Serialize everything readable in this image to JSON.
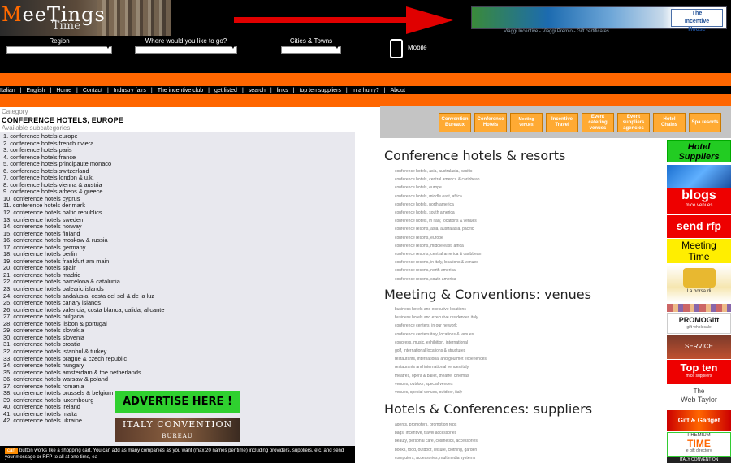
{
  "header": {
    "logo_part1_orange": "M",
    "logo_part1_rest": "eeTings",
    "logo_part2": "Time",
    "banner_logo_line1": "The",
    "banner_logo_line2": "Incentive",
    "banner_logo_line3": "House",
    "banner_sub": "Viaggi Incentive - Viaggi Premio - Gift certificates",
    "filters": [
      {
        "label": "Region"
      },
      {
        "label": "Where would you like to go?"
      },
      {
        "label": "Cities & Towns"
      }
    ],
    "mobile_label": "Mobile"
  },
  "nav": {
    "items": [
      "Italian",
      "|",
      "English",
      "|",
      "Home",
      "|",
      "Contact",
      "|",
      "Industry fairs",
      "|",
      "The incentive club",
      "|",
      "get listed",
      "|",
      "search",
      "|",
      "links",
      "|",
      "top ten suppliers",
      "|",
      "in a hurry?",
      "|",
      "About"
    ]
  },
  "left": {
    "category_label": "Category",
    "title": "CONFERENCE HOTELS, EUROPE",
    "available_label": "Available subcategories",
    "subcategories": [
      "1. conference hotels europe",
      "2. conference hotels french riviera",
      "3. conference hotels paris",
      "4. conference hotels france",
      "5. conference hotels principaute monaco",
      "6. conference hotels switzerland",
      "7. conference hotels london & u.k.",
      "8. conference hotels vienna & austria",
      "9. conference hotels athens & greece",
      "10. conference hotels cyprus",
      "11. conference hotels denmark",
      "12. conference hotels baltic republics",
      "13. conference hotels sweden",
      "14. conference hotels norway",
      "15. conference hotels finland",
      "16. conference hotels moskow & russia",
      "17. conference hotels germany",
      "18. conference hotels berlin",
      "19. conference hotels frankfurt am main",
      "20. conference hotels spain",
      "21. conference hotels madrid",
      "22. conference hotels barcelona & catalunia",
      "23. conference hotels balearic islands",
      "24. conference hotels andalusia, costa del sol & de la luz",
      "25. conference hotels canary islands",
      "26. conference hotels valencia, costa blanca, calida, alicante",
      "27. conference hotels bulgaria",
      "28. conference hotels lisbon & portugal",
      "29. conference hotels slovakia",
      "30. conference hotels slovenia",
      "31. conference hotels croatia",
      "32. conference hotels istanbul & turkey",
      "33. conference hotels prague & czech republic",
      "34. conference hotels hungary",
      "35. conference hotels amsterdam & the netherlands",
      "36. conference hotels warsaw & poland",
      "37. conference hotels romania",
      "38. conference hotels brussels & belgium",
      "39. conference hotels luxembourg",
      "40. conference hotels ireland",
      "41. conference hotels malta",
      "42. conference hotels ukraine"
    ],
    "advertise": "ADVERTISE HERE !",
    "italy_line1": "ITALY CONVENTION",
    "italy_line2": "BUREAU",
    "cart_button": "cart",
    "cart_text": "button works like a shopping cart. You can add as many companies as you want (max 20 names per time) including providers, suppliers, etc. and send your message or RFP to all at one time, ea"
  },
  "right": {
    "buttons": [
      {
        "label": "Convention Bureaux",
        "small": false
      },
      {
        "label": "Conference Hotels",
        "small": false
      },
      {
        "label": "Meeting venues",
        "small": true
      },
      {
        "label": "Incentive Travel",
        "small": false
      },
      {
        "label": "Event catering venues",
        "small": false
      },
      {
        "label": "Event suppliers agencies",
        "small": false
      },
      {
        "label": "Hotel Chains",
        "small": false
      },
      {
        "label": "Spa resorts",
        "small": false
      }
    ],
    "sections": [
      {
        "title": "Conference hotels & resorts",
        "links": [
          "conference hotels, asia, australasia, pacific",
          "conference hotels, central america & caribbean",
          "conference hotels, europe",
          "conference hotels, middle east, africa",
          "conference hotels, north america",
          "conference hotels, south america",
          "conference hotels, in italy, locations & venues",
          "conference resorts, asia, australasia, pacific",
          "conference resorts, europe",
          "conference resorts, middle east, africa",
          "conference resorts, central america & caribbean",
          "conference resorts, in italy, locations & venues",
          "conference resorts, north america",
          "conference resorts, south america"
        ]
      },
      {
        "title": "Meeting & Conventions: venues",
        "links": [
          "business hotels and executive locations",
          "business hotels and executive residences italy",
          "conference centers, in our network",
          "conference centers italy, locations & venues",
          "congress, music, exhibition, international",
          "golf, international locations & structures",
          "restaurants, international and gourmet experiences",
          "restaurants and international venues italy",
          "theatres, opera & ballet, theatre, cinemas",
          "venues, outdoor, special venues",
          "venues, special venues, outdoor, italy"
        ]
      },
      {
        "title": "Hotels & Conferences: suppliers",
        "links": [
          "agents, promoters, promotion reps",
          "bags, incentive, travel accessories",
          "beauty, personal care, cosmetics, accessories",
          "books, food, outdoor, leisure, clothing, garden",
          "computers, accessories, multimedia systems"
        ]
      }
    ]
  },
  "ads": [
    {
      "name": "hotel-suppliers-ad",
      "line1": "Hotel",
      "line2": "Suppliers"
    },
    {
      "name": "blogs-ad",
      "line1": "blogs",
      "line2": "mice venues"
    },
    {
      "name": "send-rfp-ad",
      "line1": "send rfp"
    },
    {
      "name": "meeting-time-ad",
      "line1": "Meeting",
      "line2": "Time"
    },
    {
      "name": "la-borsa-ad",
      "line1": "La borsa di"
    },
    {
      "name": "promogift-ad",
      "line1": "PROMOGift",
      "line2": "gift wholesale"
    },
    {
      "name": "service-ad",
      "line1": "SERVICE"
    },
    {
      "name": "top-ten-ad",
      "line1": "Top ten",
      "line2": "mice suppliers"
    },
    {
      "name": "web-taylor-ad",
      "line1": "The",
      "line2": "Web Taylor"
    },
    {
      "name": "gift-gadget-ad",
      "line1": "Gift & Gadget"
    },
    {
      "name": "premium-time-ad",
      "line1": "PREMIUM",
      "line2": "TIME",
      "line3": "e gift directory"
    },
    {
      "name": "italy-convention-ad",
      "line1": "ITALY CONVENTION"
    }
  ]
}
